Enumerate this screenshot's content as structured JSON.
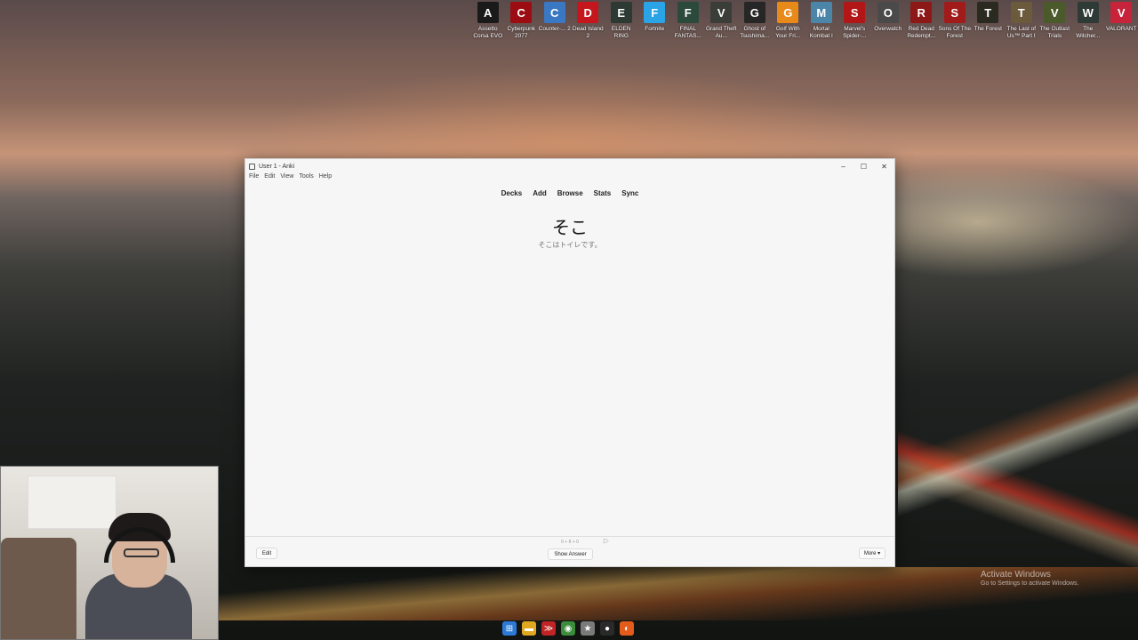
{
  "desktop_icons": [
    {
      "label": "Assetto Corsa EVO",
      "glyph": "A",
      "color": "#1a1a1a"
    },
    {
      "label": "Cyberpunk 2077",
      "glyph": "C",
      "color": "#9b0d12"
    },
    {
      "label": "Counter-... 2",
      "glyph": "C",
      "color": "#3b78c4"
    },
    {
      "label": "Dead Island 2",
      "glyph": "D",
      "color": "#c4161c"
    },
    {
      "label": "ELDEN RING",
      "glyph": "E",
      "color": "#2c3a33"
    },
    {
      "label": "Fortnite",
      "glyph": "F",
      "color": "#2aa4e6"
    },
    {
      "label": "FINAL FANTAS...",
      "glyph": "F",
      "color": "#2b4a3c"
    },
    {
      "label": "Grand Theft Au...",
      "glyph": "V",
      "color": "#3a3d38"
    },
    {
      "label": "Ghost of Tsushima...",
      "glyph": "G",
      "color": "#262626"
    },
    {
      "label": "Golf With Your Fri...",
      "glyph": "G",
      "color": "#e88a1a"
    },
    {
      "label": "Mortal Kombat I",
      "glyph": "M",
      "color": "#4b86a8"
    },
    {
      "label": "Marvel's Spider-...",
      "glyph": "S",
      "color": "#b21616"
    },
    {
      "label": "Overwatch",
      "glyph": "O",
      "color": "#4a4a4a"
    },
    {
      "label": "Red Dead Redempt...",
      "glyph": "R",
      "color": "#8c1818"
    },
    {
      "label": "Sons Of The Forest",
      "glyph": "S",
      "color": "#a21b1b"
    },
    {
      "label": "The Forest",
      "glyph": "T",
      "color": "#2a2a20"
    },
    {
      "label": "The Last of Us™ Part I",
      "glyph": "T",
      "color": "#6b5a3c"
    },
    {
      "label": "The Outlast Trials",
      "glyph": "V",
      "color": "#4a5a2a"
    },
    {
      "label": "The Witcher...",
      "glyph": "W",
      "color": "#2e3a36"
    },
    {
      "label": "VALORANT",
      "glyph": "V",
      "color": "#c7243b"
    }
  ],
  "window": {
    "title": "User 1 - Anki",
    "controls": {
      "minimize": "–",
      "maximize": "☐",
      "close": "✕"
    },
    "menu": [
      "File",
      "Edit",
      "View",
      "Tools",
      "Help"
    ],
    "toolbar": [
      "Decks",
      "Add",
      "Browse",
      "Stats",
      "Sync"
    ],
    "card": {
      "word": "そこ",
      "sentence": "そこはトイレです。"
    },
    "counts": "0 + 8 + 0",
    "buttons": {
      "edit": "Edit",
      "show_answer": "Show Answer",
      "more": "More ▾"
    }
  },
  "activate_windows": {
    "title": "Activate Windows",
    "subtitle": "Go to Settings to activate Windows."
  },
  "taskbar_icons": [
    {
      "name": "windows",
      "glyph": "⊞",
      "color": "#2d7ad6"
    },
    {
      "name": "file-explorer",
      "glyph": "▬",
      "color": "#e0a820"
    },
    {
      "name": "app-red",
      "glyph": "≫",
      "color": "#c02424"
    },
    {
      "name": "chrome",
      "glyph": "◉",
      "color": "#3b8c3b"
    },
    {
      "name": "anki",
      "glyph": "★",
      "color": "#7a7a7a"
    },
    {
      "name": "obs",
      "glyph": "●",
      "color": "#2a2a2a"
    },
    {
      "name": "firefox",
      "glyph": "◐",
      "color": "#e45c1c"
    }
  ]
}
